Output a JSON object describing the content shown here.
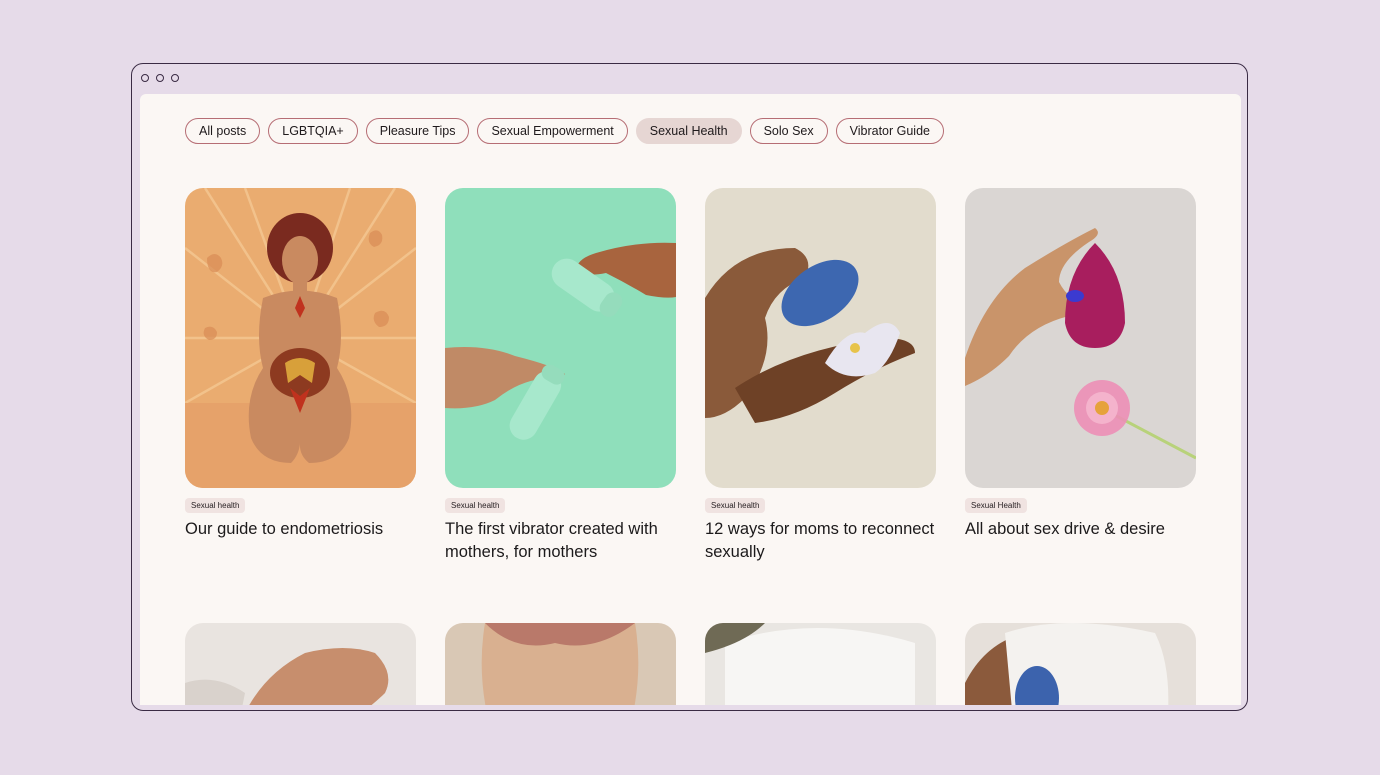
{
  "filters": [
    {
      "label": "All posts",
      "active": false
    },
    {
      "label": "LGBTQIA+",
      "active": false
    },
    {
      "label": "Pleasure Tips",
      "active": false
    },
    {
      "label": "Sexual Empowerment",
      "active": false
    },
    {
      "label": "Sexual Health",
      "active": true
    },
    {
      "label": "Solo Sex",
      "active": false
    },
    {
      "label": "Vibrator Guide",
      "active": false
    }
  ],
  "posts": [
    {
      "tag": "Sexual health",
      "title": "Our guide to endometriosis",
      "image": "endometriosis-illustration-image"
    },
    {
      "tag": "Sexual health",
      "title": "The first vibrator created with mothers, for mothers",
      "image": "mint-vibrator-hands-image"
    },
    {
      "tag": "Sexual health",
      "title": "12 ways for moms to reconnect sexually",
      "image": "blue-vibrator-orchid-image"
    },
    {
      "tag": "Sexual Health",
      "title": "All about sex drive & desire",
      "image": "pink-vibrator-flower-image"
    }
  ],
  "second_row_images": [
    "hands-image",
    "torso-bra-image",
    "white-shirt-image",
    "shoulder-vibrator-image"
  ],
  "colors": {
    "background": "#e6dbe9",
    "page": "#fbf7f4",
    "chip_border": "#b66d74",
    "chip_active": "#e6d6d3",
    "tag_bg": "#f0e3e1"
  }
}
